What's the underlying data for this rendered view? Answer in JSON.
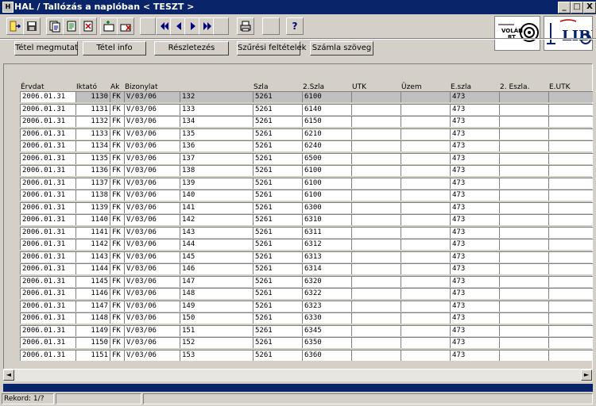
{
  "window": {
    "title": "HAL / Tallózás a naplóban  < TESZT >"
  },
  "titlebar_buttons": {
    "minimize": "_",
    "maximize": "□",
    "close": "X"
  },
  "logos": {
    "left": {
      "lines": [
        "VOLÁN",
        "RT"
      ]
    },
    "right": {
      "text": "LIBRA"
    }
  },
  "toolbar": {
    "help_label": "?",
    "icons": [
      "exit-icon",
      "save-icon",
      "copy-document-icon",
      "document-icon",
      "delete-document-icon",
      "add-row-icon",
      "delete-row-icon",
      "first-record-icon",
      "previous-record-icon",
      "next-record-icon",
      "last-record-icon",
      "print-icon",
      "help-icon"
    ]
  },
  "actions": {
    "tetel_megmutat": "Tétel megmutat",
    "tetel_info": "Tétel info",
    "reszletezes": "Részletezés",
    "szuresi_feltetelek": "Szűrési feltételek",
    "szamla_szoveg": "Számla szöveg"
  },
  "table": {
    "headers": [
      "Érvdat",
      "Iktató",
      "Ak",
      "Bizonylat",
      "",
      "Szla",
      "2.Szla",
      "UTK",
      "Üzem",
      "E.szla",
      "2. Eszla.",
      "E.UTK"
    ],
    "selected_row": 0,
    "rows": [
      [
        "2006.01.31",
        "1130",
        "FK",
        "V/03/06",
        "132",
        "5261",
        "6100",
        "",
        "",
        "473",
        "",
        ""
      ],
      [
        "2006.01.31",
        "1131",
        "FK",
        "V/03/06",
        "133",
        "5261",
        "6140",
        "",
        "",
        "473",
        "",
        ""
      ],
      [
        "2006.01.31",
        "1132",
        "FK",
        "V/03/06",
        "134",
        "5261",
        "6150",
        "",
        "",
        "473",
        "",
        ""
      ],
      [
        "2006.01.31",
        "1133",
        "FK",
        "V/03/06",
        "135",
        "5261",
        "6210",
        "",
        "",
        "473",
        "",
        ""
      ],
      [
        "2006.01.31",
        "1134",
        "FK",
        "V/03/06",
        "136",
        "5261",
        "6240",
        "",
        "",
        "473",
        "",
        ""
      ],
      [
        "2006.01.31",
        "1135",
        "FK",
        "V/03/06",
        "137",
        "5261",
        "6500",
        "",
        "",
        "473",
        "",
        ""
      ],
      [
        "2006.01.31",
        "1136",
        "FK",
        "V/03/06",
        "138",
        "5261",
        "6100",
        "",
        "",
        "473",
        "",
        ""
      ],
      [
        "2006.01.31",
        "1137",
        "FK",
        "V/03/06",
        "139",
        "5261",
        "6100",
        "",
        "",
        "473",
        "",
        ""
      ],
      [
        "2006.01.31",
        "1138",
        "FK",
        "V/03/06",
        "140",
        "5261",
        "6100",
        "",
        "",
        "473",
        "",
        ""
      ],
      [
        "2006.01.31",
        "1139",
        "FK",
        "V/03/06",
        "141",
        "5261",
        "6300",
        "",
        "",
        "473",
        "",
        ""
      ],
      [
        "2006.01.31",
        "1140",
        "FK",
        "V/03/06",
        "142",
        "5261",
        "6310",
        "",
        "",
        "473",
        "",
        ""
      ],
      [
        "2006.01.31",
        "1141",
        "FK",
        "V/03/06",
        "143",
        "5261",
        "6311",
        "",
        "",
        "473",
        "",
        ""
      ],
      [
        "2006.01.31",
        "1142",
        "FK",
        "V/03/06",
        "144",
        "5261",
        "6312",
        "",
        "",
        "473",
        "",
        ""
      ],
      [
        "2006.01.31",
        "1143",
        "FK",
        "V/03/06",
        "145",
        "5261",
        "6313",
        "",
        "",
        "473",
        "",
        ""
      ],
      [
        "2006.01.31",
        "1144",
        "FK",
        "V/03/06",
        "146",
        "5261",
        "6314",
        "",
        "",
        "473",
        "",
        ""
      ],
      [
        "2006.01.31",
        "1145",
        "FK",
        "V/03/06",
        "147",
        "5261",
        "6320",
        "",
        "",
        "473",
        "",
        ""
      ],
      [
        "2006.01.31",
        "1146",
        "FK",
        "V/03/06",
        "148",
        "5261",
        "6322",
        "",
        "",
        "473",
        "",
        ""
      ],
      [
        "2006.01.31",
        "1147",
        "FK",
        "V/03/06",
        "149",
        "5261",
        "6323",
        "",
        "",
        "473",
        "",
        ""
      ],
      [
        "2006.01.31",
        "1148",
        "FK",
        "V/03/06",
        "150",
        "5261",
        "6330",
        "",
        "",
        "473",
        "",
        ""
      ],
      [
        "2006.01.31",
        "1149",
        "FK",
        "V/03/06",
        "151",
        "5261",
        "6345",
        "",
        "",
        "473",
        "",
        ""
      ],
      [
        "2006.01.31",
        "1150",
        "FK",
        "V/03/06",
        "152",
        "5261",
        "6350",
        "",
        "",
        "473",
        "",
        ""
      ],
      [
        "2006.01.31",
        "1151",
        "FK",
        "V/03/06",
        "153",
        "5261",
        "6360",
        "",
        "",
        "473",
        "",
        ""
      ]
    ]
  },
  "scrollbar": {
    "left_arrow": "◄",
    "right_arrow": "►"
  },
  "status": {
    "record": "Rekord: 1/?"
  },
  "colors": {
    "titlebar": "#0a246a",
    "selection": "#c0c0c0",
    "face": "#d4d0c8"
  }
}
